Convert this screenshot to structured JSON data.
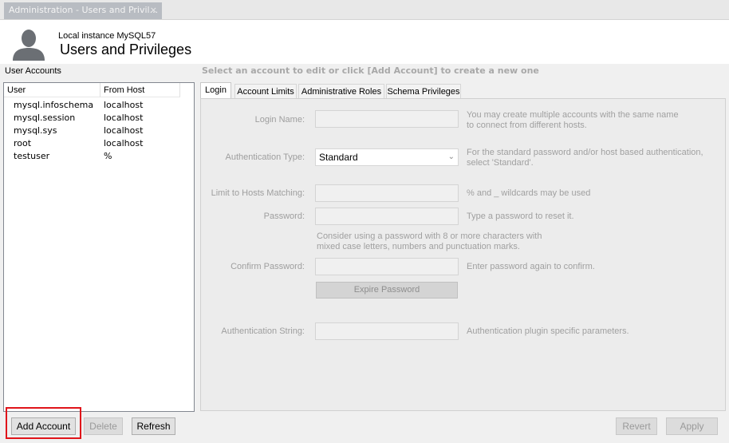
{
  "tab": {
    "title": "Administration - Users and Privil...",
    "close": "×"
  },
  "header": {
    "instance": "Local instance MySQL57",
    "title": "Users and Privileges"
  },
  "accounts": {
    "label": "User Accounts",
    "columns": [
      "User",
      "From Host"
    ],
    "rows": [
      {
        "user": "mysql.infoschema",
        "host": "localhost"
      },
      {
        "user": "mysql.session",
        "host": "localhost"
      },
      {
        "user": "mysql.sys",
        "host": "localhost"
      },
      {
        "user": "root",
        "host": "localhost"
      },
      {
        "user": "testuser",
        "host": "%"
      }
    ]
  },
  "buttons": {
    "add": "Add Account",
    "delete": "Delete",
    "refresh": "Refresh",
    "revert": "Revert",
    "apply": "Apply"
  },
  "main": {
    "hint": "Select an account to edit or click [Add Account] to create a new one",
    "tabs": [
      "Login",
      "Account Limits",
      "Administrative Roles",
      "Schema Privileges"
    ],
    "login": {
      "login_name_label": "Login Name:",
      "login_name_value": "",
      "login_name_note_1": "You may create multiple accounts with the same name",
      "login_name_note_2": "to connect from different hosts.",
      "auth_type_label": "Authentication Type:",
      "auth_type_value": "Standard",
      "auth_type_note_1": "For the standard password and/or host based authentication,",
      "auth_type_note_2": "select 'Standard'.",
      "hosts_label": "Limit to Hosts Matching:",
      "hosts_value": "",
      "hosts_note": "% and _ wildcards may be used",
      "password_label": "Password:",
      "password_value": "",
      "password_note": "Type a password to reset it.",
      "password_help_1": "Consider using a password with 8 or more characters with",
      "password_help_2": "mixed case letters, numbers and punctuation marks.",
      "confirm_label": "Confirm Password:",
      "confirm_value": "",
      "confirm_note": "Enter password again to confirm.",
      "expire_button": "Expire Password",
      "auth_string_label": "Authentication String:",
      "auth_string_value": "",
      "auth_string_note": "Authentication plugin specific parameters."
    }
  },
  "colors": {
    "highlight": "#e0141a",
    "panel": "#ececec",
    "tab_inactive": "#b8bcc2"
  },
  "icons": {
    "avatar": "user-silhouette-icon",
    "select": "chevron-down-icon",
    "close": "close-icon"
  }
}
